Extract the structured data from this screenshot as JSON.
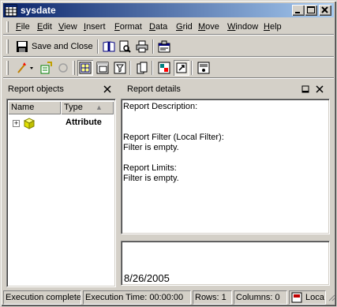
{
  "window": {
    "title": "sysdate",
    "buttons": {
      "minimize": "_",
      "maximize": "□",
      "close": "✕"
    }
  },
  "menu": [
    "File",
    "Edit",
    "View",
    "Insert",
    "Format",
    "Data",
    "Grid",
    "Move",
    "Window",
    "Help"
  ],
  "toolbar1": {
    "save_close_label": "Save and Close",
    "icons": [
      "book-icon",
      "print-preview-icon",
      "print-icon",
      "properties-icon"
    ]
  },
  "toolbar2": {
    "icons": [
      "wand-icon",
      "run-icon",
      "refresh-icon",
      "grid-view-icon",
      "design-view-icon",
      "filter-icon",
      "page-by-icon",
      "sql-view-icon",
      "link-icon",
      "export-icon"
    ]
  },
  "report_objects": {
    "title": "Report objects",
    "columns": [
      "Name",
      "Type"
    ],
    "sort_indicator": "▲",
    "rows": [
      {
        "type": "Attribute"
      }
    ]
  },
  "report_details": {
    "title": "Report details",
    "lines": [
      "Report Description:",
      "",
      "",
      "Report Filter (Local Filter):",
      "Filter is empty.",
      "",
      "Report Limits:",
      "Filter is empty."
    ]
  },
  "result": {
    "value": "8/26/2005"
  },
  "status": {
    "execution": "Execution complete",
    "time": "Execution Time: 00:00:00",
    "rows": "Rows: 1",
    "columns": "Columns: 0",
    "locale": "Loca"
  },
  "colors": {
    "title_start": "#0a246a",
    "title_end": "#a6caf0",
    "face": "#d4d0c8"
  }
}
